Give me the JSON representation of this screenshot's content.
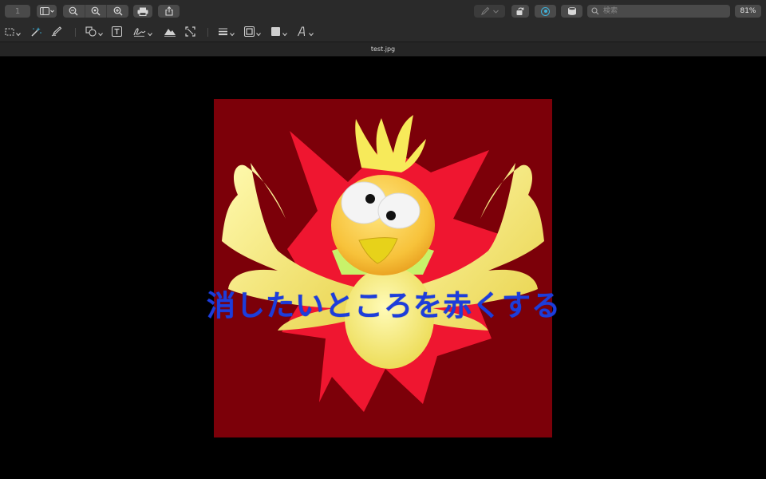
{
  "window": {
    "title": "test.jpg"
  },
  "toolbar": {
    "page_number": "1",
    "search_placeholder": "検索",
    "search_value": "",
    "zoom_level": "81%",
    "icons": {
      "sidebar": "sidebar-icon",
      "zoom_out": "zoom-out-icon",
      "zoom_actual": "zoom-actual-icon",
      "zoom_in": "zoom-in-icon",
      "print": "print-icon",
      "share": "share-icon",
      "pen": "pen-icon",
      "rotate": "rotate-icon",
      "markup": "markup-icon",
      "stack": "stack-icon",
      "search": "search-icon"
    }
  },
  "markup_toolbar": {
    "tools": [
      "rect-select-icon",
      "instant-alpha-icon",
      "sketch-icon",
      "shapes-icon",
      "text-icon",
      "sign-icon",
      "adjust-color-icon",
      "resize-icon",
      "line-style-icon",
      "border-color-icon",
      "fill-color-icon",
      "text-style-icon"
    ]
  },
  "document": {
    "overlay_text": "消したいところを赤くする",
    "colors": {
      "background": "#7c0009",
      "burst": "#ef1630",
      "bird": "#f7ef6a",
      "text": "#1d3ddb"
    }
  }
}
